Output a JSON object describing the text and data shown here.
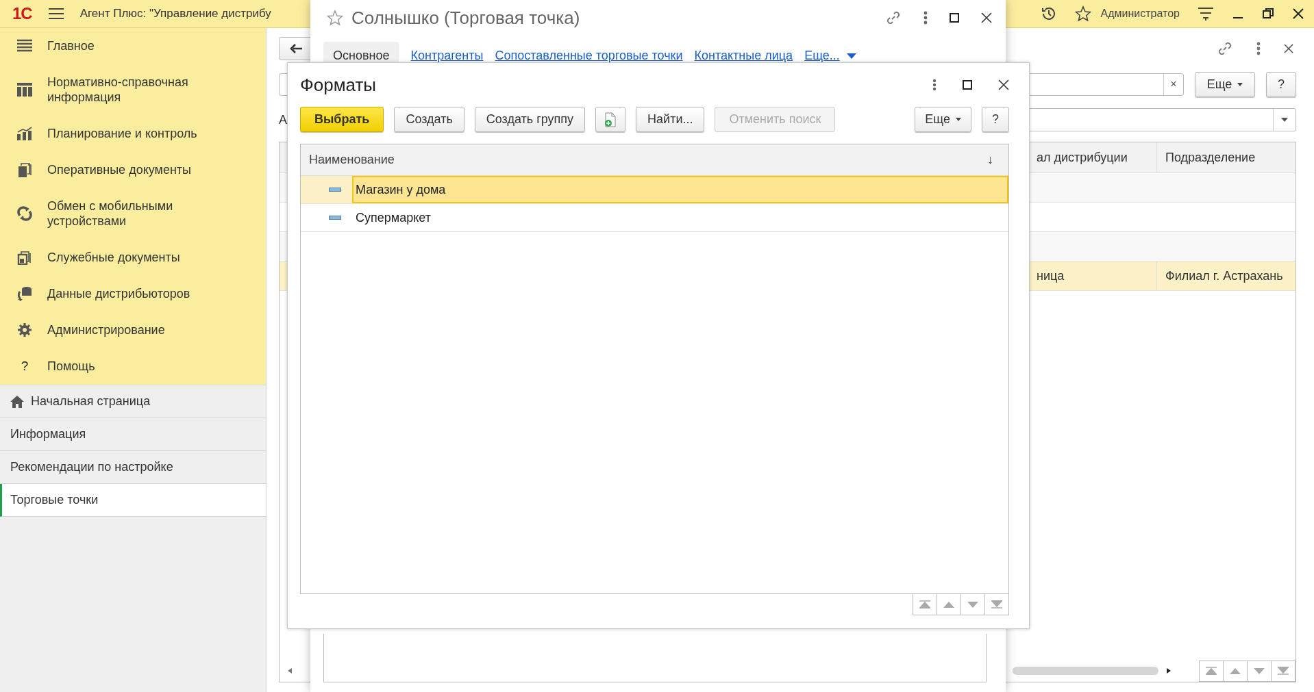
{
  "app_bar": {
    "logo": "1С",
    "title": "Агент Плюс: \"Управление дистрибу",
    "user": "Администратор"
  },
  "sidebar": {
    "sections": [
      {
        "label": "Главное",
        "kind": "menu"
      },
      {
        "label": "Нормативно-справочная информация",
        "kind": "catalog"
      },
      {
        "label": "Планирование и контроль",
        "kind": "chart"
      },
      {
        "label": "Оперативные документы",
        "kind": "docs"
      },
      {
        "label": "Обмен с мобильными устройствами",
        "kind": "sync"
      },
      {
        "label": "Служебные документы",
        "kind": "service"
      },
      {
        "label": "Данные дистрибьюторов",
        "kind": "data"
      },
      {
        "label": "Администрирование",
        "kind": "gear"
      },
      {
        "label": "Помощь",
        "kind": "help",
        "glyph": "?"
      }
    ],
    "pages": [
      {
        "label": "Начальная страница",
        "kind": "home",
        "selected": false
      },
      {
        "label": "Информация",
        "kind": "page",
        "selected": false
      },
      {
        "label": "Рекомендации по настройке",
        "kind": "page",
        "selected": false
      },
      {
        "label": "Торговые точки",
        "kind": "page",
        "selected": true
      }
    ]
  },
  "background_form": {
    "label_fragment": "А",
    "search_clear": "×",
    "more_button": "Еще",
    "help_button": "?",
    "table": {
      "columns": [
        "ал дистрибуции",
        "Подразделение"
      ],
      "rows": [
        {
          "selected": false
        },
        {
          "selected": false
        },
        {
          "selected": false
        },
        {
          "selected": true,
          "cells": [
            "ница",
            "Филиал г. Астрахань"
          ]
        }
      ]
    }
  },
  "object_window": {
    "title": "Солнышко (Торговая точка)",
    "tabs": [
      {
        "label": "Основное",
        "kind": "tab",
        "selected": true
      },
      {
        "label": "Контрагенты",
        "kind": "tab",
        "selected": false
      },
      {
        "label": "Сопоставленные торговые точки",
        "kind": "tab",
        "selected": false
      },
      {
        "label": "Контактные лица",
        "kind": "tab",
        "selected": false
      },
      {
        "label": "Еще...",
        "kind": "menu",
        "selected": false
      }
    ]
  },
  "dialog": {
    "title": "Форматы",
    "buttons": [
      {
        "label": "Выбрать",
        "kind": "primary",
        "disabled": false
      },
      {
        "label": "Создать",
        "kind": "normal",
        "disabled": false
      },
      {
        "label": "Создать группу",
        "kind": "normal",
        "disabled": false
      },
      {
        "kind": "icon",
        "disabled": false
      },
      {
        "label": "Найти...",
        "kind": "normal",
        "disabled": false
      },
      {
        "label": "Отменить поиск",
        "kind": "normal",
        "disabled": true
      }
    ],
    "right_buttons": [
      {
        "label": "Еще",
        "kind": "dropdown",
        "disabled": false
      },
      {
        "label": "?",
        "kind": "normal",
        "disabled": false
      }
    ],
    "table": {
      "column": "Наименование",
      "sort": "↓",
      "rows": [
        {
          "name": "Магазин у дома",
          "selected": true
        },
        {
          "name": "Супермаркет",
          "selected": false
        }
      ]
    }
  }
}
